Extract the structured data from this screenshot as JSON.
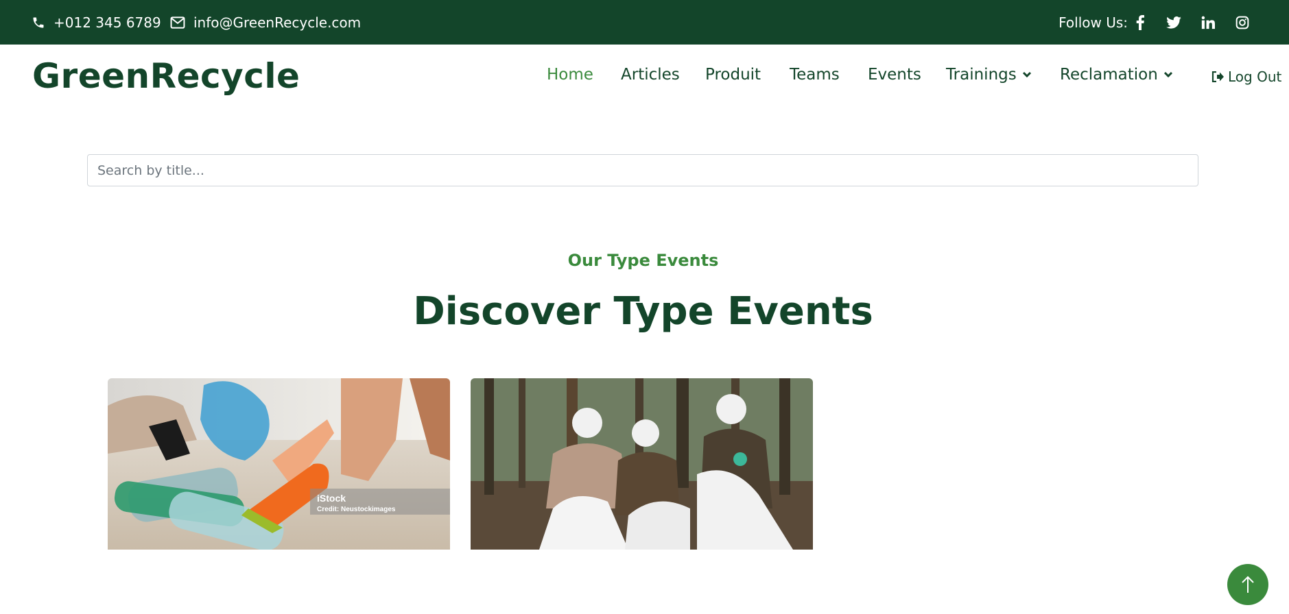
{
  "topbar": {
    "phone": "+012 345 6789",
    "email": "info@GreenRecycle.com",
    "follow_label": "Follow Us:",
    "socials": [
      "facebook-icon",
      "twitter-icon",
      "linkedin-icon",
      "instagram-icon"
    ]
  },
  "brand": "GreenRecycle",
  "nav": {
    "items": [
      {
        "label": "Home",
        "active": true
      },
      {
        "label": "Articles"
      },
      {
        "label": "Produit"
      },
      {
        "label": "Teams"
      },
      {
        "label": "Events"
      },
      {
        "label": "Trainings",
        "dropdown": true
      },
      {
        "label": "Reclamation",
        "dropdown": true
      }
    ],
    "logout_label": "Log Out"
  },
  "search": {
    "placeholder": "Search by title..."
  },
  "section": {
    "subtitle": "Our Type Events",
    "title": "Discover Type Events"
  },
  "cards": [
    {
      "watermark": "iStock",
      "credit": "Credit: Neustockimages"
    },
    {}
  ],
  "colors": {
    "primary_dark": "#13452a",
    "accent_green": "#3a8a3c"
  }
}
